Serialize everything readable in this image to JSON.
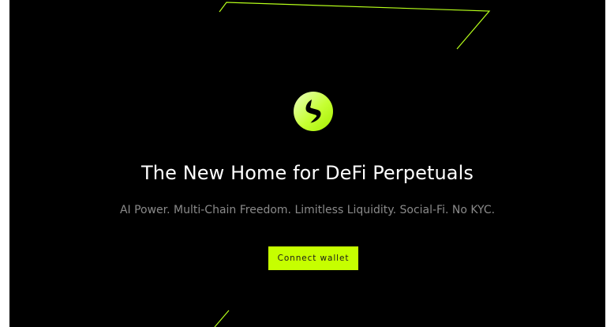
{
  "hero": {
    "logo_icon": "bolt-logo-icon",
    "headline": "The New Home for DeFi Perpetuals",
    "subline": "AI Power. Multi-Chain Freedom. Limitless Liquidity. Social-Fi. No KYC.",
    "cta_label": "Connect wallet"
  },
  "colors": {
    "background": "#000000",
    "accent": "#c6ff00",
    "headline": "#ffffff",
    "subline": "#8a8a8a"
  }
}
